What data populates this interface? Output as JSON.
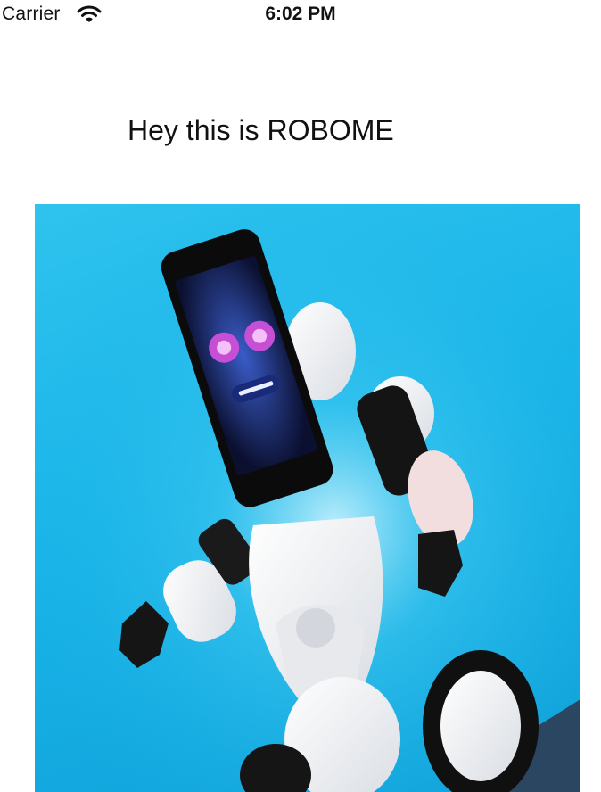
{
  "status_bar": {
    "carrier": "Carrier",
    "time": "6:02 PM",
    "icons": {
      "signal": "wifi-icon"
    }
  },
  "main": {
    "title": "Hey this is ROBOME",
    "image": {
      "subject": "robot-photo"
    }
  },
  "colors": {
    "background": "#ffffff",
    "text": "#111111",
    "photo_sky": "#19b4e8"
  }
}
